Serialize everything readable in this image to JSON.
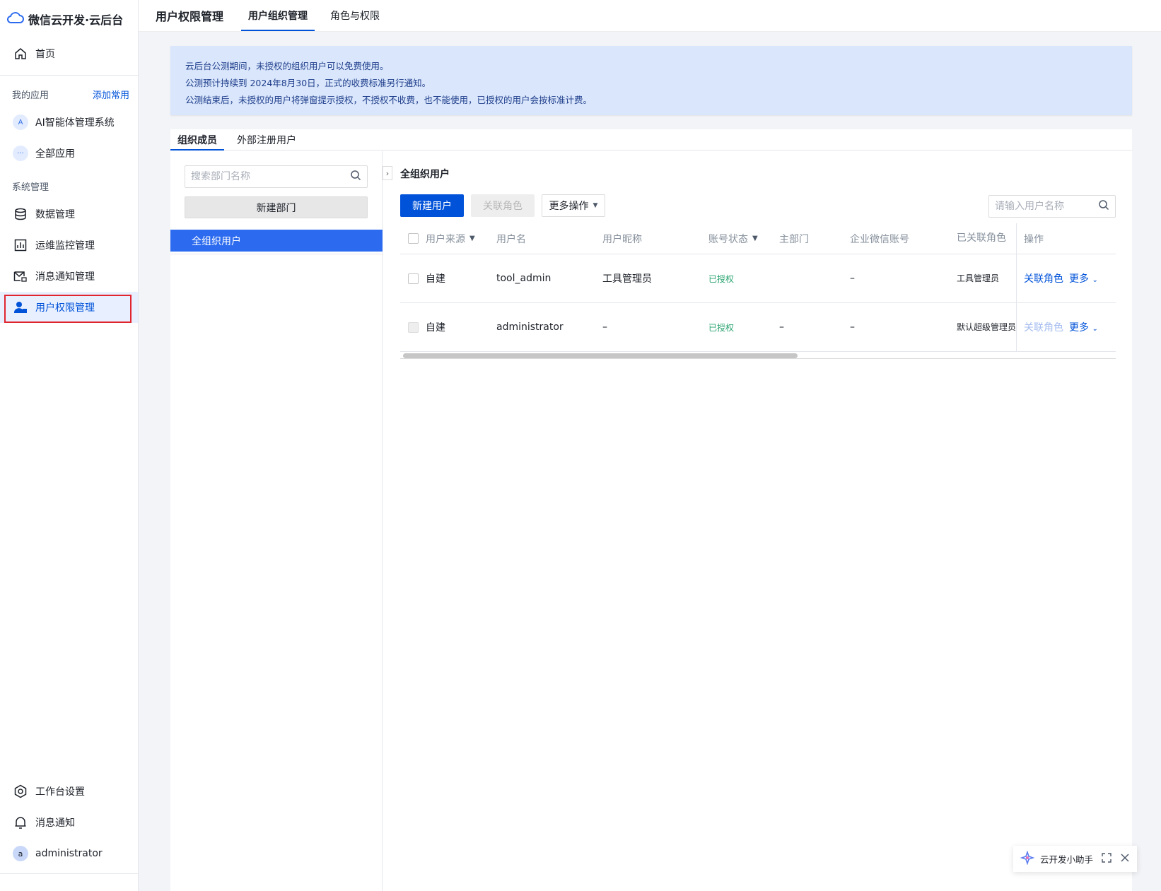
{
  "brand": {
    "name": "微信云开发·云后台"
  },
  "sidebar": {
    "home": "首页",
    "my_apps_label": "我的应用",
    "add_common": "添加常用",
    "apps": [
      {
        "icon": "A",
        "label": "AI智能体管理系统"
      },
      {
        "icon": "···",
        "label": "全部应用"
      }
    ],
    "system_label": "系统管理",
    "system_items": [
      {
        "label": "数据管理"
      },
      {
        "label": "运维监控管理"
      },
      {
        "label": "消息通知管理"
      },
      {
        "label": "用户权限管理"
      }
    ],
    "bottom": {
      "settings": "工作台设置",
      "notifications": "消息通知",
      "user_avatar": "a",
      "user_name": "administrator"
    }
  },
  "header": {
    "title": "用户权限管理",
    "tabs": [
      {
        "label": "用户组织管理",
        "active": true
      },
      {
        "label": "角色与权限",
        "active": false
      }
    ]
  },
  "notice": {
    "lines": [
      "云后台公测期间，未授权的组织用户可以免费使用。",
      "公测预计持续到 2024年8月30日，正式的收费标准另行通知。",
      "公测结束后，未授权的用户将弹窗提示授权，不授权不收费，也不能使用，已授权的用户会按标准计费。"
    ]
  },
  "card": {
    "tabs": [
      {
        "label": "组织成员",
        "active": true
      },
      {
        "label": "外部注册用户",
        "active": false
      }
    ]
  },
  "left_panel": {
    "search_placeholder": "搜索部门名称",
    "new_dept": "新建部门",
    "dept_selected": "全组织用户"
  },
  "right_panel": {
    "heading": "全组织用户",
    "new_user": "新建用户",
    "link_role": "关联角色",
    "more_ops": "更多操作",
    "user_search_placeholder": "请输入用户名称"
  },
  "table": {
    "columns": [
      "用户来源",
      "用户名",
      "用户昵称",
      "账号状态",
      "主部门",
      "企业微信账号",
      "已关联角色",
      "操作"
    ],
    "rows": [
      {
        "source": "自建",
        "username": "tool_admin",
        "nickname": "工具管理员",
        "status": "已授权",
        "dept": "",
        "wx": "–",
        "role": "工具管理员",
        "op_link": "关联角色",
        "op_more": "更多",
        "disabled": false
      },
      {
        "source": "自建",
        "username": "administrator",
        "nickname": "–",
        "status": "已授权",
        "dept": "–",
        "wx": "–",
        "role": "默认超级管理员",
        "op_link": "关联角色",
        "op_more": "更多",
        "disabled": true
      }
    ]
  },
  "assistant": {
    "label": "云开发小助手"
  },
  "colors": {
    "primary": "#0052d9",
    "active_bg": "#e8f0ff",
    "notice_bg": "#d9e6fb",
    "status_green": "#2ba471",
    "highlight_border": "#e0252f"
  }
}
